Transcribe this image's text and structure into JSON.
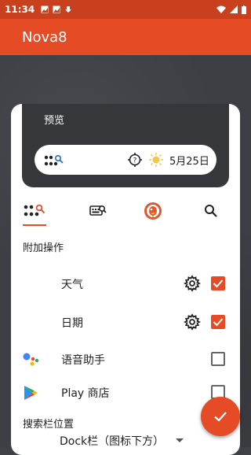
{
  "status_bar": {
    "time": "11:34"
  },
  "app_bar": {
    "title": "Nova8"
  },
  "preview": {
    "label": "预览",
    "date": "5月25日"
  },
  "sections": {
    "additional_actions": "附加操作",
    "search_bar_position": "搜索栏位置"
  },
  "rows": [
    {
      "label": "天气",
      "checked": true
    },
    {
      "label": "日期",
      "checked": true
    },
    {
      "label": "语音助手",
      "checked": false
    },
    {
      "label": "Play 商店",
      "checked": false
    }
  ],
  "dropdown": {
    "value": "Dock栏（图标下方）"
  },
  "colors": {
    "accent": "#e54b25",
    "status": "#c9401f",
    "preview_bg": "#35373b"
  }
}
